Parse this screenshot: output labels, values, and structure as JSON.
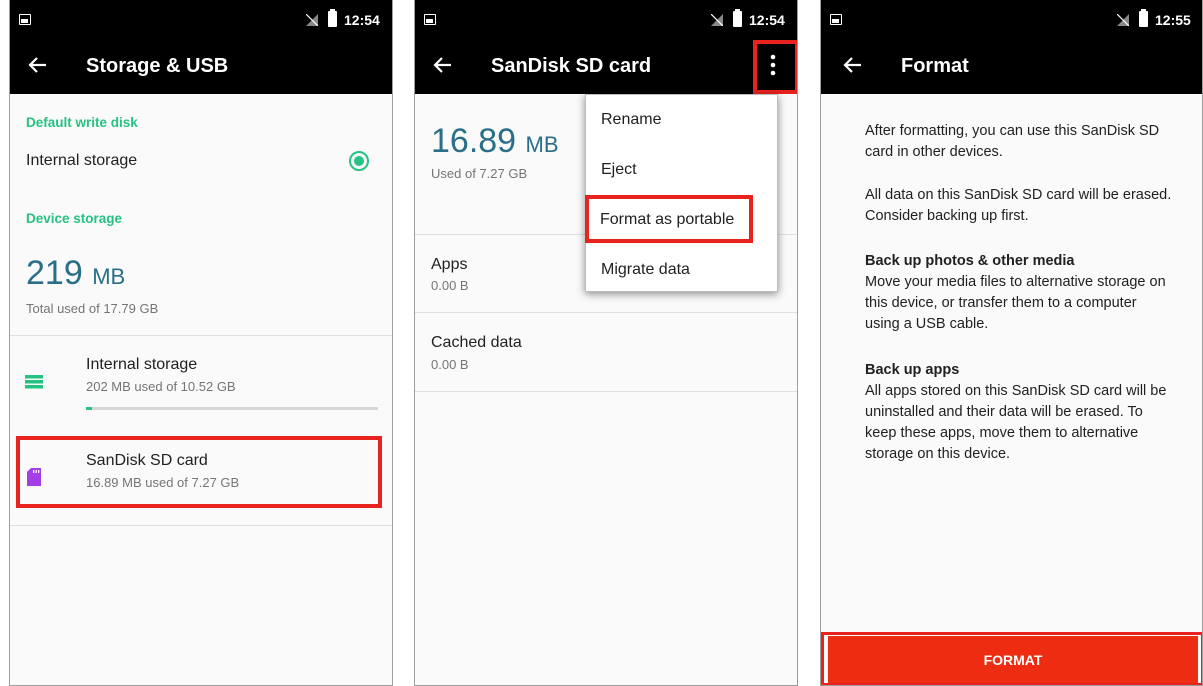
{
  "screen1": {
    "time": "12:54",
    "title": "Storage & USB",
    "default_write_disk_header": "Default write disk",
    "default_write_disk_value": "Internal storage",
    "device_storage_header": "Device storage",
    "total_value": "219",
    "total_unit": "MB",
    "total_caption": "Total used of 17.79 GB",
    "internal": {
      "title": "Internal storage",
      "summary": "202 MB used of 10.52 GB",
      "progress": 0.02
    },
    "sdcard": {
      "title": "SanDisk SD card",
      "summary": "16.89 MB used of 7.27 GB"
    },
    "colors": {
      "accent": "#26c281",
      "internal_icon": "#26c281",
      "sd_icon": "#a43ee6",
      "highlight": "#e8231e"
    }
  },
  "screen2": {
    "time": "12:54",
    "title": "SanDisk SD card",
    "used_value": "16.89",
    "used_unit": "MB",
    "used_caption": "Used of 7.27 GB",
    "rows": [
      {
        "title": "Apps",
        "value": "0.00 B"
      },
      {
        "title": "Cached data",
        "value": "0.00 B"
      }
    ],
    "menu": [
      "Rename",
      "Eject",
      "Format as portable",
      "Migrate data"
    ]
  },
  "screen3": {
    "time": "12:55",
    "title": "Format",
    "para1": "After formatting, you can use this SanDisk SD card in other devices.",
    "para2": "All data on this SanDisk SD card will be erased. Consider backing up first.",
    "photos_heading": "Back up photos & other media",
    "photos_body": "Move your media files to alternative storage on this device, or transfer them to a computer using a USB cable.",
    "apps_heading": "Back up apps",
    "apps_body": "All apps stored on this SanDisk SD card will be uninstalled and their data will be erased. To keep these apps, move them to alternative storage on this device.",
    "button": "FORMAT",
    "colors": {
      "button": "#ee2c12"
    }
  }
}
